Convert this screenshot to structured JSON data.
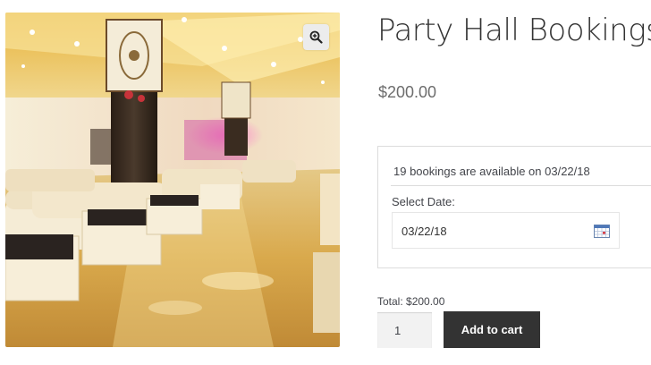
{
  "product": {
    "title": "Party Hall Bookings",
    "price": "$200.00",
    "image_alt": "Decorated banquet hall interior with cream sofas"
  },
  "gallery": {
    "zoom_icon": "zoom-in-icon"
  },
  "booking": {
    "availability_text": "19 bookings are available on 03/22/18",
    "date_label": "Select Date:",
    "date_value": "03/22/18",
    "calendar_icon": "calendar-icon"
  },
  "cart": {
    "total_text": "Total: $200.00",
    "quantity": "1",
    "add_to_cart_label": "Add to cart"
  },
  "colors": {
    "button_bg": "#333333",
    "button_text": "#ffffff",
    "title_text": "#333333",
    "price_text": "#6d6d6d",
    "border": "#dcdcdc"
  }
}
